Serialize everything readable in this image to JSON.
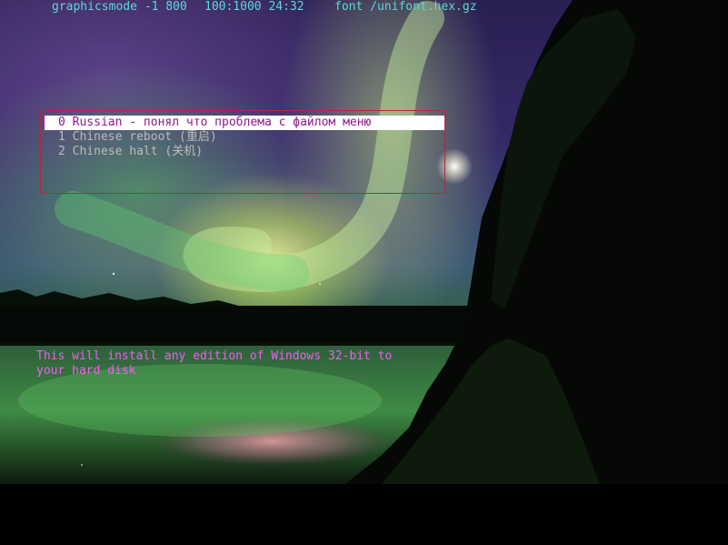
{
  "header": {
    "graphics_mode": "graphicsmode -1 800",
    "resolution_timer": "100:1000 24:32",
    "font": "font /unifont.hex.gz"
  },
  "menu": {
    "items": [
      {
        "index": "0",
        "label": "0 Russian - понял что проблема с файлом меню",
        "selected": true
      },
      {
        "index": "1",
        "label": "1 Chinese reboot (重启)",
        "selected": false
      },
      {
        "index": "2",
        "label": "2 Chinese halt (关机)",
        "selected": false
      }
    ],
    "selection_indicator_icon": "triangle-right-icon"
  },
  "description": {
    "line1": "This will install any edition of Windows 32-bit to",
    "line2": "your hard disk"
  },
  "colors": {
    "header_text": "#5fd7d7",
    "menu_border": "#b2283c",
    "menu_text": "#bcbcbc",
    "menu_selected_bg": "#ffffff",
    "menu_selected_text": "#8c1a8c",
    "description_text": "#ee5fee"
  }
}
